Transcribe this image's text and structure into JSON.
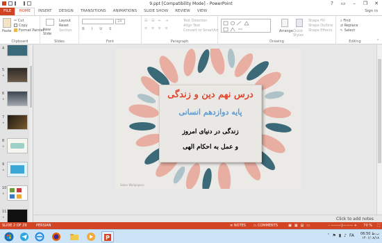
{
  "window": {
    "title": "9.ppt [Compatibility Mode] - PowerPoint",
    "controls": [
      "?",
      "▭",
      "–",
      "❐",
      "✕"
    ],
    "signin": "Sign in"
  },
  "tabs": [
    "FILE",
    "HOME",
    "INSERT",
    "DESIGN",
    "TRANSITIONS",
    "ANIMATIONS",
    "SLIDE SHOW",
    "REVIEW",
    "VIEW"
  ],
  "ribbon": {
    "clipboard": {
      "label": "Clipboard",
      "paste": "Paste",
      "cut": "Cut",
      "copy": "Copy",
      "format_painter": "Format Painter"
    },
    "slides": {
      "label": "Slides",
      "new_slide": "New Slide",
      "layout": "Layout",
      "reset": "Reset",
      "section": "Section"
    },
    "font": {
      "label": "Font",
      "size": "24"
    },
    "paragraph": {
      "label": "Paragraph",
      "text_direction": "Text Direction",
      "align_text": "Align Text",
      "smartart": "Convert to SmartArt"
    },
    "drawing": {
      "label": "Drawing",
      "arrange": "Arrange",
      "quick_styles": "Quick Styles",
      "shape_fill": "Shape Fill",
      "shape_outline": "Shape Outline",
      "shape_effects": "Shape Effects"
    },
    "editing": {
      "label": "Editing",
      "find": "Find",
      "replace": "Replace",
      "select": "Select"
    }
  },
  "thumbnails": [
    "4",
    "5",
    "6",
    "7",
    "8",
    "9",
    "10",
    "11"
  ],
  "slide": {
    "line1": "درس نهم دین و زندگی",
    "line2": "پایه دوازدهم انسانی",
    "line3": "زندگی در دنیای امروز",
    "line4": "و عمل به احکام الهی",
    "footer": "Salon Wallpapers"
  },
  "notes_placeholder": "Click to add notes",
  "status": {
    "slide": "SLIDE 2 OF 29",
    "language": "PERSIAN",
    "notes": "NOTES",
    "comments": "COMMENTS",
    "zoom": "70 %"
  },
  "taskbar": {
    "lang": "FA",
    "time": "06:50 ب.ظ",
    "date": "۱۴۰۱/۰۸/۱۸"
  },
  "colors": {
    "accent": "#d04423",
    "title_red": "#e0472e",
    "title_blue": "#5b9bd5",
    "leaf_teal": "#2c5f6f",
    "leaf_pink": "#e8a89a"
  }
}
